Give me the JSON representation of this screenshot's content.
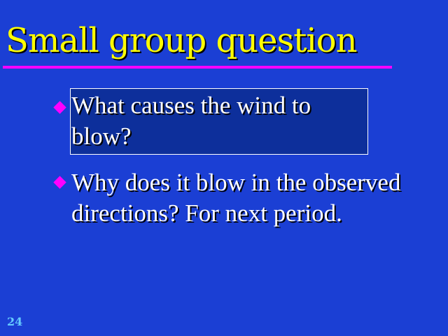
{
  "slide": {
    "title": "Small group question",
    "bullets": [
      {
        "text": "What causes the wind to blow?"
      },
      {
        "text": "Why does it  blow in the observed directions? For next period."
      }
    ],
    "page_number": "24",
    "colors": {
      "background": "#1b3fd4",
      "title": "#ffff00",
      "rule": "#ff00ff",
      "bullet_marker": "#ff00ff",
      "body_text": "#ffffff",
      "highlight_box": "#0d2f9b",
      "page_number": "#66ccff"
    },
    "bullet_marker_icon": "diamond-icon"
  }
}
